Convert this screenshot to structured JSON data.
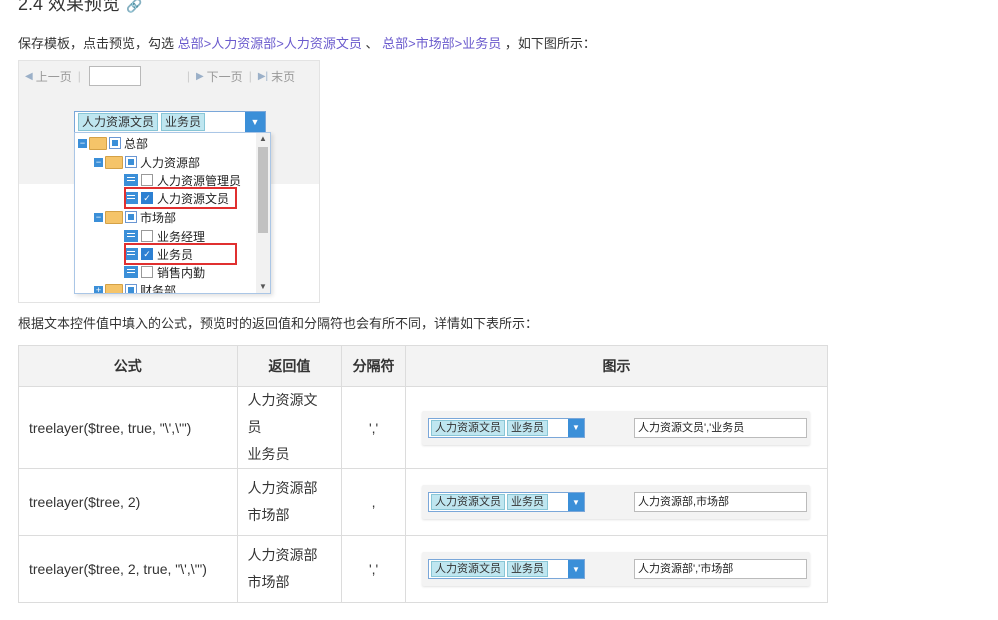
{
  "heading": {
    "text": "2.4 效果预览"
  },
  "intro": {
    "prefix": "保存模板，点击预览，勾选",
    "path1": "总部>人力资源部>人力资源文员",
    "mid": "、",
    "path2": "总部>市场部>业务员",
    "suffix": "，如下图所示："
  },
  "pager": {
    "prev": "上一页",
    "next": "下一页",
    "last": "末页"
  },
  "combo": {
    "chips": [
      "人力资源文员",
      "业务员"
    ]
  },
  "tree": {
    "root": "总部",
    "dept1": "人力资源部",
    "role1": "人力资源管理员",
    "role2": "人力资源文员",
    "dept2": "市场部",
    "role3": "业务经理",
    "role4": "业务员",
    "role5": "销售内勤",
    "dept3": "财务部"
  },
  "para2": "根据文本控件值中填入的公式，预览时的返回值和分隔符也会有所不同，详情如下表所示：",
  "table": {
    "headers": [
      "公式",
      "返回值",
      "分隔符",
      "图示"
    ],
    "rows": [
      {
        "formula": "treelayer($tree, true, \"\\',\\'\")",
        "ret1": "人力资源文员",
        "ret2": "业务员",
        "sep": "','",
        "chip1": "人力资源文员",
        "chip2": "业务员",
        "preview": "人力资源文员','业务员"
      },
      {
        "formula": "treelayer($tree, 2)",
        "ret1": "人力资源部",
        "ret2": "市场部",
        "sep": ",",
        "chip1": "人力资源文员",
        "chip2": "业务员",
        "preview": "人力资源部,市场部"
      },
      {
        "formula": "treelayer($tree, 2, true, \"\\',\\'\")",
        "ret1": "人力资源部",
        "ret2": "市场部",
        "sep": "','",
        "chip1": "人力资源文员",
        "chip2": "业务员",
        "preview": "人力资源部','市场部"
      }
    ]
  }
}
